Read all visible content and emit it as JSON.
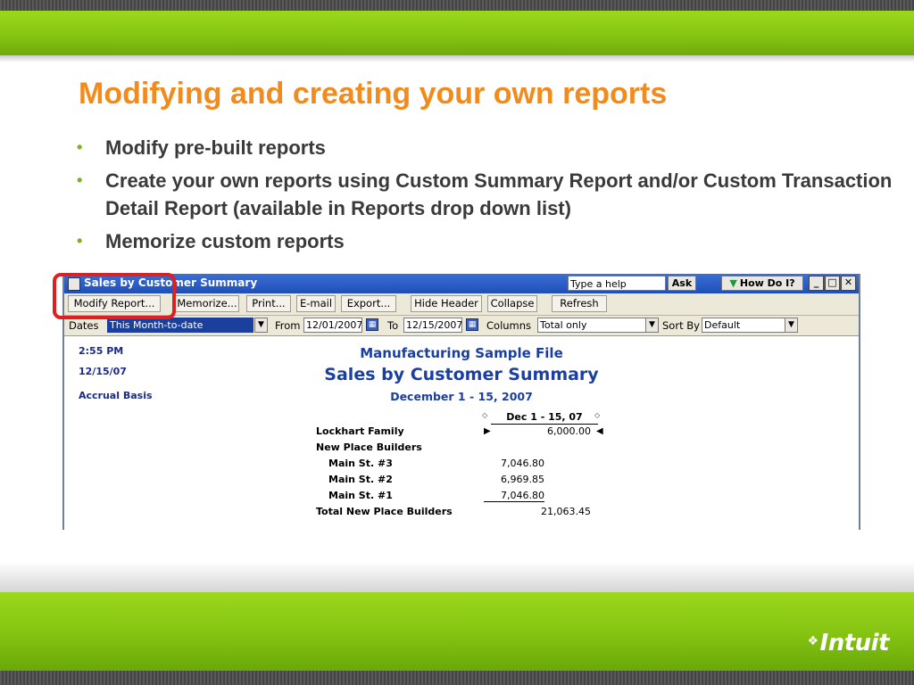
{
  "slide": {
    "title": "Modifying and creating your own reports",
    "bullets": [
      "Modify pre-built reports",
      "Create your own reports using Custom Summary Report and/or Custom Transaction Detail Report (available in Reports drop down list)",
      "Memorize custom reports"
    ],
    "bullet_char": "•",
    "logo": "Intuit"
  },
  "window": {
    "title": "Sales by Customer Summary",
    "help_placeholder": "Type a help question",
    "ask_label": "Ask",
    "how_do_i_label": "How Do I?",
    "controls": [
      "_",
      "□",
      "✕"
    ]
  },
  "toolbar": {
    "buttons": [
      "Modify Report...",
      "Memorize...",
      "Print...",
      "E-mail",
      "Export...",
      "Hide Header",
      "Collapse",
      "Refresh"
    ]
  },
  "filters": {
    "dates_label": "Dates",
    "dates_value": "This Month-to-date",
    "from_label": "From",
    "from_value": "12/01/2007",
    "to_label": "To",
    "to_value": "12/15/2007",
    "columns_label": "Columns",
    "columns_value": "Total only",
    "sortby_label": "Sort By",
    "sortby_value": "Default"
  },
  "report": {
    "time": "2:55 PM",
    "date": "12/15/07",
    "basis": "Accrual Basis",
    "company": "Manufacturing Sample File",
    "title": "Sales by Customer Summary",
    "period": "December 1 - 15, 2007",
    "column_header": "Dec 1 - 15, 07",
    "rows": [
      {
        "label": "Lockhart Family",
        "value": "",
        "total": "6,000.00"
      },
      {
        "label": "New Place Builders",
        "value": "",
        "total": ""
      },
      {
        "label": "Main St. #3",
        "value": "7,046.80",
        "total": ""
      },
      {
        "label": "Main St. #2",
        "value": "6,969.85",
        "total": ""
      },
      {
        "label": "Main St. #1",
        "value": "7,046.80",
        "total": ""
      },
      {
        "label": "Total New Place Builders",
        "value": "",
        "total": "21,063.45"
      }
    ]
  },
  "colors": {
    "title_orange": "#f28a1c",
    "band_green": "#86c512",
    "highlight_red": "#e02020",
    "report_blue": "#1a3fa0"
  }
}
